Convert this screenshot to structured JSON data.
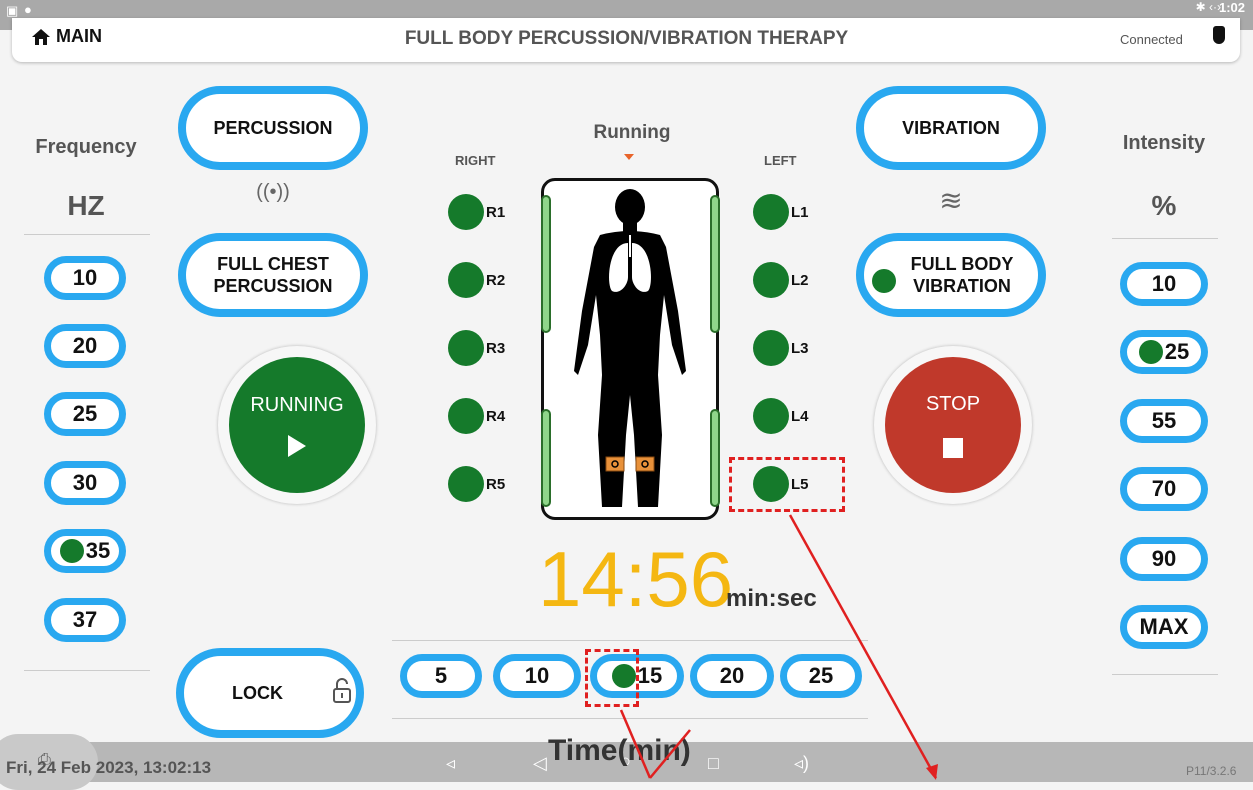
{
  "status_bar": {
    "time": "1:02",
    "connectivity": "✱ ‹·›"
  },
  "header": {
    "home_label": "MAIN",
    "title": "FULL BODY PERCUSSION/VIBRATION THERAPY",
    "connection_status": "Connected"
  },
  "frequency": {
    "label": "Frequency",
    "unit": "HZ",
    "options": [
      "10",
      "20",
      "25",
      "30",
      "35",
      "37"
    ],
    "selected": "35"
  },
  "intensity": {
    "label": "Intensity",
    "unit": "%",
    "options": [
      "10",
      "25",
      "55",
      "70",
      "90",
      "MAX"
    ],
    "selected": "25"
  },
  "modes": {
    "percussion": "PERCUSSION",
    "percussion_glyph": "((•))",
    "full_chest_line1": "FULL CHEST",
    "full_chest_line2": "PERCUSSION",
    "vibration": "VIBRATION",
    "vibration_glyph": "≋",
    "full_body_line1": "FULL BODY",
    "full_body_line2": "VIBRATION"
  },
  "controls": {
    "running_label": "RUNNING",
    "stop_label": "STOP",
    "lock_label": "LOCK"
  },
  "body_panel": {
    "state": "Running",
    "right_label": "RIGHT",
    "left_label": "LEFT",
    "right_zones": [
      "R1",
      "R2",
      "R3",
      "R4",
      "R5"
    ],
    "left_zones": [
      "L1",
      "L2",
      "L3",
      "L4",
      "L5"
    ]
  },
  "timer": {
    "value": "14:56",
    "unit": "min:sec"
  },
  "time": {
    "options": [
      "5",
      "10",
      "15",
      "20",
      "25"
    ],
    "selected": "15",
    "label": "Time(min)"
  },
  "footer": {
    "datetime": "Fri, 24 Feb 2023, 13:02:13",
    "version": "P11/3.2.6"
  },
  "colors": {
    "accent": "#29a8f0",
    "active_green": "#157a2b",
    "stop_red": "#c0392b",
    "timer": "#f4b712",
    "annotation": "#e02020"
  },
  "icons": [
    "home-icon",
    "radio-waves-icon",
    "waves-icon",
    "play-icon",
    "stop-square-icon",
    "padlock-icon",
    "screenshot-icon",
    "volume-down-icon",
    "back-icon",
    "home-nav-icon",
    "recents-icon",
    "volume-up-icon",
    "plug-icon"
  ]
}
